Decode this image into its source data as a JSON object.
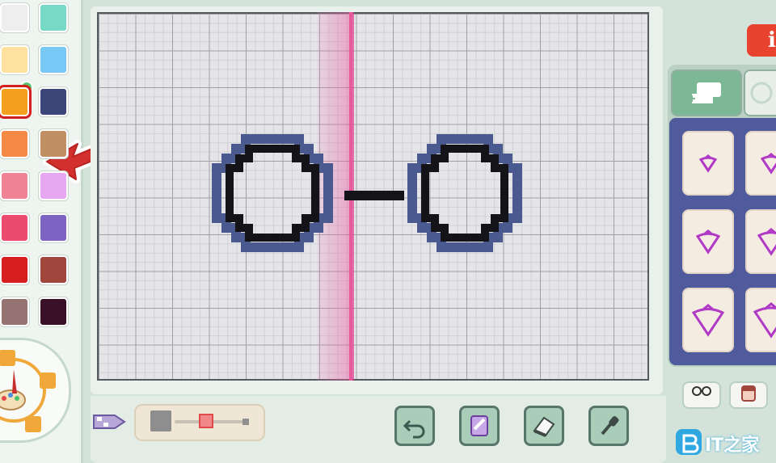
{
  "palette": {
    "swatches": [
      {
        "name": "swatch-light-gray",
        "color": "#eeeeee"
      },
      {
        "name": "swatch-mint",
        "color": "#78d9c7"
      },
      {
        "name": "swatch-light-yellow",
        "color": "#ffe1a0"
      },
      {
        "name": "swatch-sky-blue",
        "color": "#78c8f5"
      },
      {
        "name": "swatch-orange",
        "color": "#f5a01e",
        "selected": true
      },
      {
        "name": "swatch-navy",
        "color": "#3c4678"
      },
      {
        "name": "swatch-coral-orange",
        "color": "#f58a46"
      },
      {
        "name": "swatch-tan",
        "color": "#c09064"
      },
      {
        "name": "swatch-pink",
        "color": "#f08296"
      },
      {
        "name": "swatch-lavender",
        "color": "#e6a8f0"
      },
      {
        "name": "swatch-rose",
        "color": "#eb4b6e"
      },
      {
        "name": "swatch-purple",
        "color": "#7d64c3"
      },
      {
        "name": "swatch-red",
        "color": "#d71e1e"
      },
      {
        "name": "swatch-brick",
        "color": "#a0463c"
      },
      {
        "name": "swatch-mauve-brown",
        "color": "#967373"
      },
      {
        "name": "swatch-dark-plum",
        "color": "#3a0f28"
      }
    ]
  },
  "header": {
    "top_button_label": "i"
  },
  "colors": {
    "accent_red": "#e8432f",
    "canvas_bg": "#e5e5e8",
    "mirror_pink": "#e8589a",
    "stamp_panel": "#4f5b9c",
    "stamp_outline": "#b03ac6"
  },
  "brush": {
    "size_level": 0.45
  },
  "tools": [
    "undo-icon",
    "stamp-tool-icon",
    "eraser-icon",
    "eyedropper-icon"
  ],
  "watermark": {
    "text": "IT之家"
  }
}
